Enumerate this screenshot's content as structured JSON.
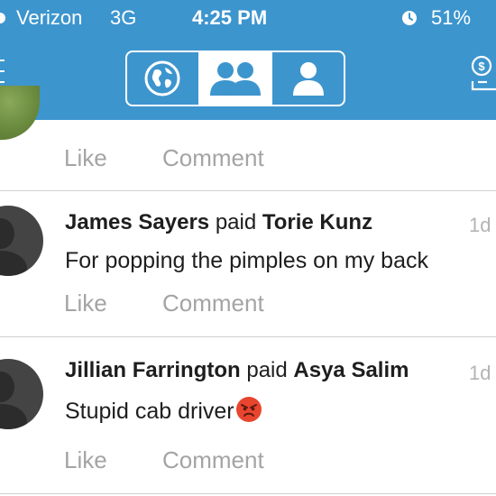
{
  "status_bar": {
    "carrier": "Verizon",
    "network": "3G",
    "time": "4:25 PM",
    "battery": "51%"
  },
  "nav": {
    "segments": [
      "globe-icon",
      "friends-icon",
      "person-icon"
    ],
    "active_segment": "friends-icon",
    "right_icon": "dollar-request-icon"
  },
  "colors": {
    "brand_blue": "#3d95ce",
    "text_dark": "#1e1e1e",
    "text_muted": "#a4a4a4",
    "divider": "#cfcfcf"
  },
  "top_actions": {
    "like": "Like",
    "comment": "Comment"
  },
  "posts": [
    {
      "actor": "James Sayers",
      "verb": "paid",
      "target": "Torie Kunz",
      "time": "1d",
      "note": "For popping the pimples on my back",
      "like": "Like",
      "comment": "Comment"
    },
    {
      "actor": "Jillian Farrington",
      "verb": "paid",
      "target": "Asya Salim",
      "time": "1d",
      "note": "Stupid cab driver",
      "emoji": "angry-face-emoji",
      "like": "Like",
      "comment": "Comment"
    }
  ]
}
